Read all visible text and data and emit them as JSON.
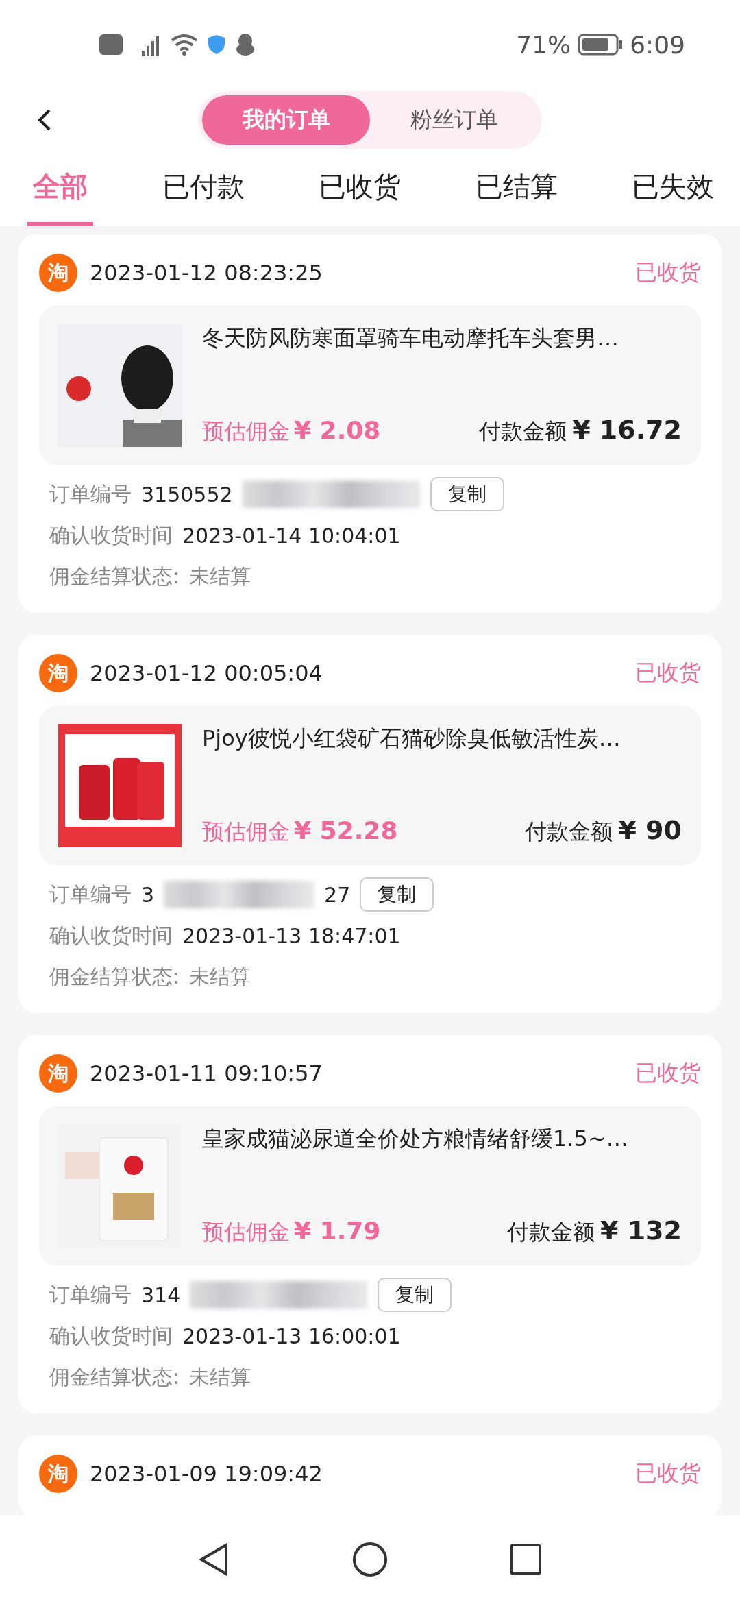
{
  "status_bar": {
    "battery": "71%",
    "time": "6:09"
  },
  "header": {
    "segments": [
      {
        "label": "我的订单",
        "selected": true
      },
      {
        "label": "粉丝订单",
        "selected": false
      }
    ]
  },
  "tabs": [
    {
      "label": "全部",
      "selected": true
    },
    {
      "label": "已付款",
      "selected": false
    },
    {
      "label": "已收货",
      "selected": false
    },
    {
      "label": "已结算",
      "selected": false
    },
    {
      "label": "已失效",
      "selected": false
    }
  ],
  "orders": [
    {
      "platform": "淘",
      "time": "2023-01-12 08:23:25",
      "status": "已收货",
      "title": "冬天防风防寒面罩骑车电动摩托车头套男…",
      "commission_label": "预估佣金",
      "commission": "¥ 2.08",
      "paid_label": "付款金额",
      "paid": "¥ 16.72",
      "order_no_label": "订单编号",
      "order_no_start": "3150552",
      "copy": "复制",
      "confirm_label": "确认收货时间",
      "confirm_time": "2023-01-14 10:04:01",
      "settle_label": "佣金结算状态:",
      "settle_status": "未结算"
    },
    {
      "platform": "淘",
      "time": "2023-01-12 00:05:04",
      "status": "已收货",
      "title": "Pjoy彼悦小红袋矿石猫砂除臭低敏活性炭…",
      "commission_label": "预估佣金",
      "commission": "¥ 52.28",
      "paid_label": "付款金额",
      "paid": "¥ 90",
      "order_no_label": "订单编号",
      "order_no_start": "3",
      "order_no_end": "27",
      "copy": "复制",
      "confirm_label": "确认收货时间",
      "confirm_time": "2023-01-13 18:47:01",
      "settle_label": "佣金结算状态:",
      "settle_status": "未结算"
    },
    {
      "platform": "淘",
      "time": "2023-01-11 09:10:57",
      "status": "已收货",
      "title": "皇家成猫泌尿道全价处方粮情绪舒缓1.5~…",
      "commission_label": "预估佣金",
      "commission": "¥ 1.79",
      "paid_label": "付款金额",
      "paid": "¥ 132",
      "order_no_label": "订单编号",
      "order_no_start": "314",
      "copy": "复制",
      "confirm_label": "确认收货时间",
      "confirm_time": "2023-01-13 16:00:01",
      "settle_label": "佣金结算状态:",
      "settle_status": "未结算"
    },
    {
      "platform": "淘",
      "time": "2023-01-09 19:09:42",
      "status": "已收货"
    }
  ]
}
